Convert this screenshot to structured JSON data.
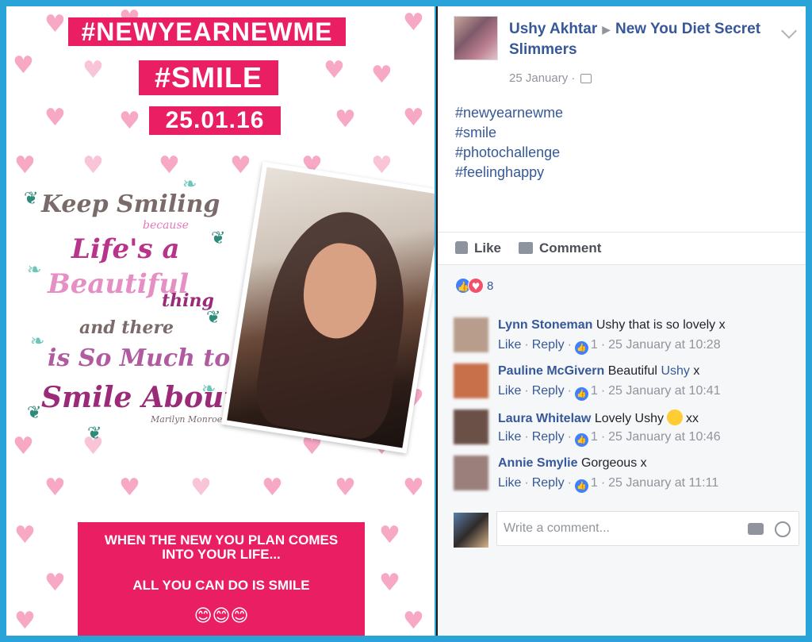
{
  "graphic": {
    "banner_hashtag": "#NEWYEARNEWME",
    "banner_smile": "#SMILE",
    "banner_date": "25.01.16",
    "quote_lines": [
      "Keep Smiling",
      "because",
      "Life's a",
      "Beautiful",
      "thing",
      "and there",
      "is So Much to",
      "Smile About"
    ],
    "quote_author": "Marilyn Monroe",
    "promo_line1": "WHEN THE NEW YOU PLAN COMES",
    "promo_line2": "INTO YOUR LIFE...",
    "promo_line3": "ALL YOU CAN DO IS SMILE",
    "promo_emoji": "😊😊😊"
  },
  "post": {
    "author": "Ushy Akhtar",
    "group": "New You Diet Secret Slimmers",
    "date": "25 January",
    "date_separator": "·",
    "hashtags": [
      "#newyearnewme",
      "#smile",
      "#photochallenge",
      "#feelinghappy"
    ],
    "like_label": "Like",
    "comment_label": "Comment",
    "reaction_count": "8"
  },
  "comments": [
    {
      "name": "Lynn Stoneman",
      "text": "Ushy that is so lovely x",
      "like": "Like",
      "reply": "Reply",
      "likes": "1",
      "time": "25 January at 10:28",
      "avatar_color": "#b89c8c"
    },
    {
      "name": "Pauline McGivern",
      "text": "Beautiful",
      "mention": "Ushy",
      "text_after": "x",
      "like": "Like",
      "reply": "Reply",
      "likes": "1",
      "time": "25 January at 10:41",
      "avatar_color": "#c7704a"
    },
    {
      "name": "Laura Whitelaw",
      "text": "Lovely Ushy",
      "text_after": "xx",
      "like": "Like",
      "reply": "Reply",
      "likes": "1",
      "time": "25 January at 10:46",
      "avatar_color": "#6b5048"
    },
    {
      "name": "Annie Smylie",
      "text": "Gorgeous x",
      "like": "Like",
      "reply": "Reply",
      "likes": "1",
      "time": "25 January at 11:11",
      "avatar_color": "#9a7f7a"
    }
  ],
  "composer": {
    "placeholder": "Write a comment..."
  },
  "colors": {
    "brand_pink": "#e91e63",
    "fb_link": "#365899",
    "frame_blue": "#2aa3d8"
  }
}
